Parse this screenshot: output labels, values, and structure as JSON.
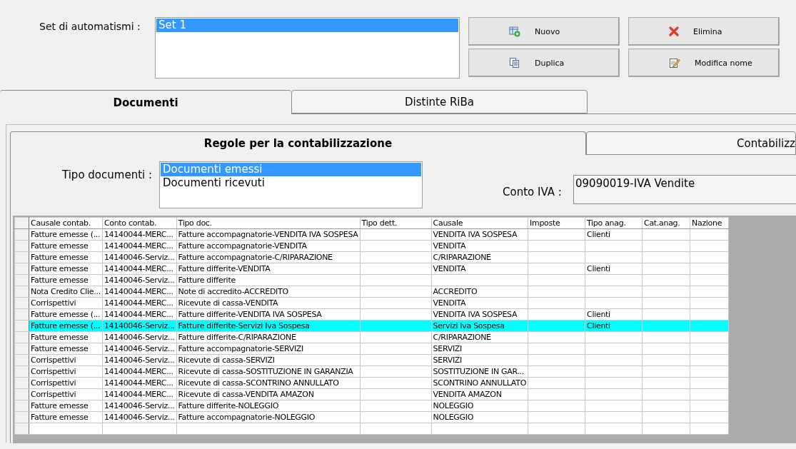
{
  "set_field": {
    "label": "Set di automatismi :",
    "items": [
      {
        "label": "Set 1",
        "selected": true
      }
    ]
  },
  "buttons": [
    {
      "label": "Nuovo",
      "kind": "new"
    },
    {
      "label": "Elimina",
      "kind": "delete"
    },
    {
      "label": "Duplica",
      "kind": "duplicate"
    },
    {
      "label": "Modifica nome",
      "kind": "rename"
    }
  ],
  "tabs": [
    {
      "label": "Documenti",
      "selected": true
    },
    {
      "label": "Distinte RiBa",
      "selected": false
    }
  ],
  "subtabs": [
    {
      "label": "Regole per la contabilizzazione",
      "selected": true
    },
    {
      "label": "Contabilizz",
      "selected": false
    }
  ],
  "tipo_documenti": {
    "label": "Tipo documenti :",
    "items": [
      {
        "label": "Documenti emessi",
        "selected": true
      },
      {
        "label": "Documenti ricevuti",
        "selected": false
      }
    ]
  },
  "conto_iva": {
    "label": "Conto IVA :",
    "value": "09090019-IVA Vendite"
  },
  "table": {
    "columns": [
      "Causale contab.",
      "Conto contab.",
      "Tipo doc.",
      "Tipo dett.",
      "Causale",
      "Imposte",
      "Tipo anag.",
      "Cat.anag.",
      "Nazione"
    ],
    "rows": [
      {
        "selected": false,
        "cells": [
          "Fatture emesse (...",
          "14140044-MERC...",
          "Fatture accompagnatorie-VENDITA IVA SOSPESA",
          null,
          "VENDITA IVA SOSPESA",
          null,
          "Clienti",
          null,
          null
        ]
      },
      {
        "selected": false,
        "cells": [
          "Fatture emesse",
          "14140044-MERC...",
          "Fatture accompagnatorie-VENDITA",
          null,
          "VENDITA",
          null,
          null,
          null,
          null
        ]
      },
      {
        "selected": false,
        "cells": [
          "Fatture emesse",
          "14140046-Serviz...",
          "Fatture accompagnatorie-C/RIPARAZIONE",
          null,
          "C/RIPARAZIONE",
          null,
          null,
          null,
          null
        ]
      },
      {
        "selected": false,
        "cells": [
          "Fatture emesse",
          "14140044-MERC...",
          "Fatture differite-VENDITA",
          null,
          "VENDITA",
          null,
          "Clienti",
          null,
          null
        ]
      },
      {
        "selected": false,
        "cells": [
          "Fatture emesse",
          "14140046-Serviz...",
          "Fatture differite",
          null,
          null,
          null,
          null,
          null,
          null
        ]
      },
      {
        "selected": false,
        "cells": [
          "Nota Credito Clie...",
          "14140044-MERC...",
          "Note di accredito-ACCREDITO",
          null,
          "ACCREDITO",
          null,
          null,
          null,
          null
        ]
      },
      {
        "selected": false,
        "cells": [
          "Corrispettivi",
          "14140044-MERC...",
          "Ricevute di cassa-VENDITA",
          null,
          "VENDITA",
          null,
          null,
          null,
          null
        ]
      },
      {
        "selected": false,
        "cells": [
          "Fatture emesse (...",
          "14140044-MERC...",
          "Fatture differite-VENDITA IVA SOSPESA",
          null,
          "VENDITA IVA SOSPESA",
          null,
          "Clienti",
          null,
          null
        ]
      },
      {
        "selected": true,
        "cells": [
          "Fatture emesse (...",
          "14140046-Serviz...",
          "Fatture differite-Servizi Iva Sospesa",
          null,
          "Servizi Iva Sospesa",
          null,
          "Clienti",
          null,
          null
        ]
      },
      {
        "selected": false,
        "cells": [
          "Fatture emesse",
          "14140046-Serviz...",
          "Fatture differite-C/RIPARAZIONE",
          null,
          "C/RIPARAZIONE",
          null,
          null,
          null,
          null
        ]
      },
      {
        "selected": false,
        "cells": [
          "Fatture emesse",
          "14140046-Serviz...",
          "Fatture accompagnatorie-SERVIZI",
          null,
          "SERVIZI",
          null,
          null,
          null,
          null
        ]
      },
      {
        "selected": false,
        "cells": [
          "Corrispettivi",
          "14140046-Serviz...",
          "Ricevute di cassa-SERVIZI",
          null,
          "SERVIZI",
          null,
          null,
          null,
          null
        ]
      },
      {
        "selected": false,
        "cells": [
          "Corrispettivi",
          "14140044-MERC...",
          "Ricevute di cassa-SOSTITUZIONE IN GARANZIA",
          null,
          "SOSTITUZIONE IN GAR...",
          null,
          null,
          null,
          null
        ]
      },
      {
        "selected": false,
        "cells": [
          "Corrispettivi",
          "14140044-MERC...",
          "Ricevute di cassa-SCONTRINO ANNULLATO",
          null,
          "SCONTRINO ANNULLATO",
          null,
          null,
          null,
          null
        ]
      },
      {
        "selected": false,
        "cells": [
          "Corrispettivi",
          "14140044-MERC...",
          "Ricevute di cassa-VENDITA AMAZON",
          null,
          "VENDITA AMAZON",
          null,
          null,
          null,
          null
        ]
      },
      {
        "selected": false,
        "cells": [
          "Fatture emesse",
          "14140046-Serviz...",
          "Fatture differite-NOLEGGIO",
          null,
          "NOLEGGIO",
          null,
          null,
          null,
          null
        ]
      },
      {
        "selected": false,
        "cells": [
          "Fatture emesse",
          "14140046-Serviz...",
          "Fatture accompagnatorie-NOLEGGIO",
          null,
          "NOLEGGIO",
          null,
          null,
          null,
          null
        ]
      }
    ]
  }
}
